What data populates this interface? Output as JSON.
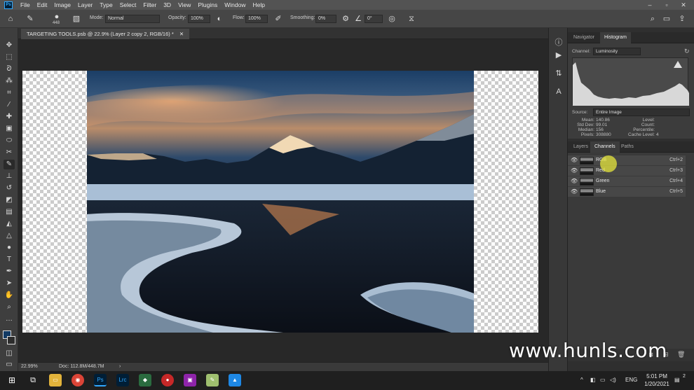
{
  "menu": {
    "logo": "Ps",
    "items": [
      "File",
      "Edit",
      "Image",
      "Layer",
      "Type",
      "Select",
      "Filter",
      "3D",
      "View",
      "Plugins",
      "Window",
      "Help"
    ]
  },
  "options": {
    "brush_size": "448",
    "mode_label": "Mode:",
    "mode_value": "Normal",
    "opacity_label": "Opacity:",
    "opacity_value": "100%",
    "flow_label": "Flow:",
    "flow_value": "100%",
    "smoothing_label": "Smoothing:",
    "smoothing_value": "0%",
    "angle_value": "0°"
  },
  "document": {
    "tab_title": "TARGETING TOOLS.psb @ 22.9% (Layer 2 copy 2, RGB/16) *"
  },
  "status": {
    "zoom": "22.99%",
    "doc": "Doc: 112.8M/448.7M"
  },
  "histogram_panel": {
    "tabs": [
      "Navigator",
      "Histogram"
    ],
    "active_tab": "Histogram",
    "channel_label": "Channel:",
    "channel_value": "Luminosity",
    "source_label": "Source:",
    "source_value": "Entire Image",
    "stats_left": [
      {
        "label": "Mean:",
        "value": "140.86"
      },
      {
        "label": "Std Dev:",
        "value": "99.01"
      },
      {
        "label": "Median:",
        "value": "156"
      },
      {
        "label": "Pixels:",
        "value": "308880"
      }
    ],
    "stats_right": [
      {
        "label": "Level:",
        "value": ""
      },
      {
        "label": "Count:",
        "value": ""
      },
      {
        "label": "Percentile:",
        "value": ""
      },
      {
        "label": "Cache Level:",
        "value": "4"
      }
    ]
  },
  "channels_panel": {
    "tabs": [
      "Layers",
      "Channels",
      "Paths"
    ],
    "active_tab": "Channels",
    "rows": [
      {
        "name": "RGB",
        "shortcut": "Ctrl+2"
      },
      {
        "name": "Red",
        "shortcut": "Ctrl+3"
      },
      {
        "name": "Green",
        "shortcut": "Ctrl+4"
      },
      {
        "name": "Blue",
        "shortcut": "Ctrl+5"
      }
    ]
  },
  "taskbar": {
    "lang": "ENG",
    "time": "5:01 PM",
    "date": "1/20/2021",
    "notifications": "2"
  },
  "watermark": "www.hunls.com",
  "colors": {
    "accent": "#31a8ff",
    "menubar": "#535353",
    "panel": "#3c3c3c"
  }
}
